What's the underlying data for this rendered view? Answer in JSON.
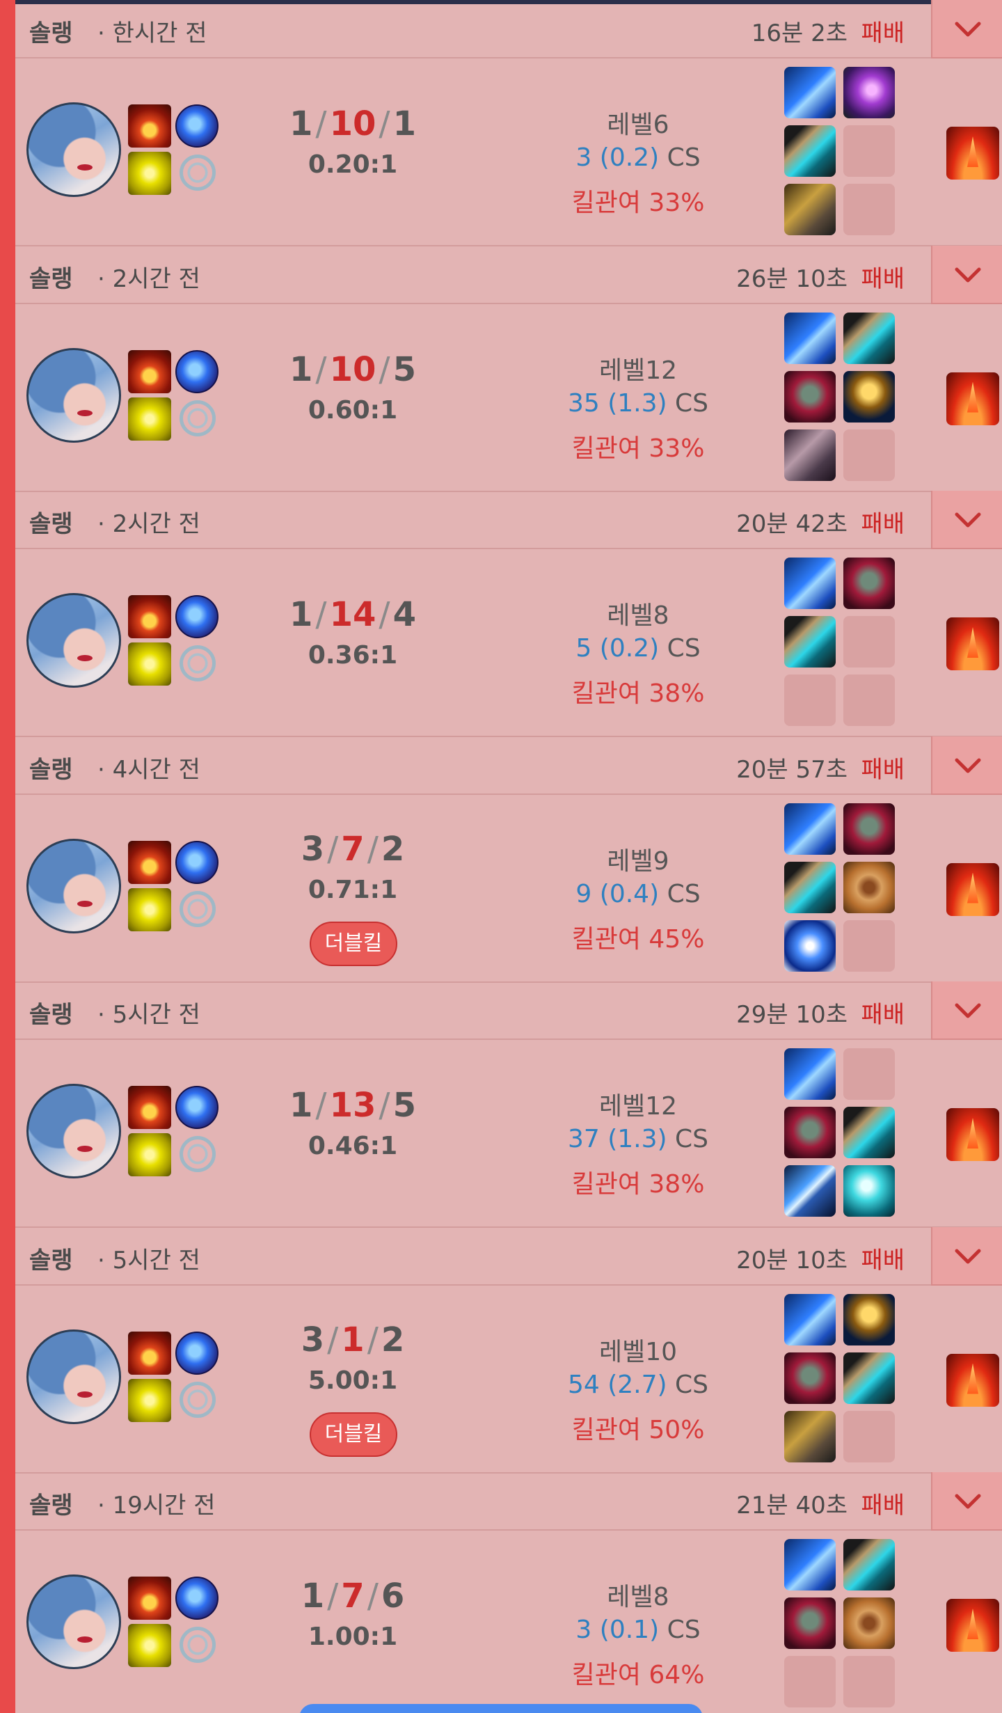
{
  "colors": {
    "accent": "#e84a4a",
    "loss": "#cc2222",
    "cs": "#2e80c0",
    "kp": "#d83a3a",
    "badge": "#e95a57",
    "row_bg": "#e3b4b4"
  },
  "matches": [
    {
      "queue": "솔랭",
      "ago": "· 한시간 전",
      "duration": "16분 2초",
      "result": "패배",
      "kills": "1",
      "deaths": "10",
      "assists": "1",
      "ratio": "0.20:1",
      "badge": null,
      "level": "레벨6",
      "cs_value": "3 (0.2)",
      "cs_label": "CS",
      "kill_participation": "킬관여 33%",
      "items": [
        "blue-sword",
        "purple-gem",
        "boots",
        "",
        "gold-chest",
        ""
      ]
    },
    {
      "queue": "솔랭",
      "ago": "· 2시간 전",
      "duration": "26분 10초",
      "result": "패배",
      "kills": "1",
      "deaths": "10",
      "assists": "5",
      "ratio": "0.60:1",
      "badge": null,
      "level": "레벨12",
      "cs_value": "35 (1.3)",
      "cs_label": "CS",
      "kill_participation": "킬관여 33%",
      "items": [
        "blue-sword",
        "boots",
        "armor",
        "cup",
        "gem",
        ""
      ]
    },
    {
      "queue": "솔랭",
      "ago": "· 2시간 전",
      "duration": "20분 42초",
      "result": "패배",
      "kills": "1",
      "deaths": "14",
      "assists": "4",
      "ratio": "0.36:1",
      "badge": null,
      "level": "레벨8",
      "cs_value": "5 (0.2)",
      "cs_label": "CS",
      "kill_participation": "킬관여 38%",
      "items": [
        "blue-sword",
        "armor",
        "boots",
        "",
        "",
        ""
      ]
    },
    {
      "queue": "솔랭",
      "ago": "· 4시간 전",
      "duration": "20분 57초",
      "result": "패배",
      "kills": "3",
      "deaths": "7",
      "assists": "2",
      "ratio": "0.71:1",
      "badge": "더블킬",
      "level": "레벨9",
      "cs_value": "9 (0.4)",
      "cs_label": "CS",
      "kill_participation": "킬관여 45%",
      "items": [
        "blue-sword",
        "armor",
        "boots",
        "cookie",
        "sapphire",
        ""
      ]
    },
    {
      "queue": "솔랭",
      "ago": "· 5시간 전",
      "duration": "29분 10초",
      "result": "패배",
      "kills": "1",
      "deaths": "13",
      "assists": "5",
      "ratio": "0.46:1",
      "badge": null,
      "level": "레벨12",
      "cs_value": "37 (1.3)",
      "cs_label": "CS",
      "kill_participation": "킬관여 38%",
      "items": [
        "blue-sword",
        "",
        "armor",
        "boots",
        "sword",
        "orb"
      ]
    },
    {
      "queue": "솔랭",
      "ago": "· 5시간 전",
      "duration": "20분 10초",
      "result": "패배",
      "kills": "3",
      "deaths": "1",
      "assists": "2",
      "ratio": "5.00:1",
      "badge": "더블킬",
      "level": "레벨10",
      "cs_value": "54 (2.7)",
      "cs_label": "CS",
      "kill_participation": "킬관여 50%",
      "items": [
        "blue-sword",
        "cup",
        "armor",
        "boots",
        "gold-chest",
        ""
      ]
    },
    {
      "queue": "솔랭",
      "ago": "· 19시간 전",
      "duration": "21분 40초",
      "result": "패배",
      "kills": "1",
      "deaths": "7",
      "assists": "6",
      "ratio": "1.00:1",
      "badge": null,
      "level": "레벨8",
      "cs_value": "3 (0.1)",
      "cs_label": "CS",
      "kill_participation": "킬관여 64%",
      "items": [
        "blue-sword",
        "boots",
        "armor",
        "cookie",
        "",
        ""
      ]
    }
  ]
}
